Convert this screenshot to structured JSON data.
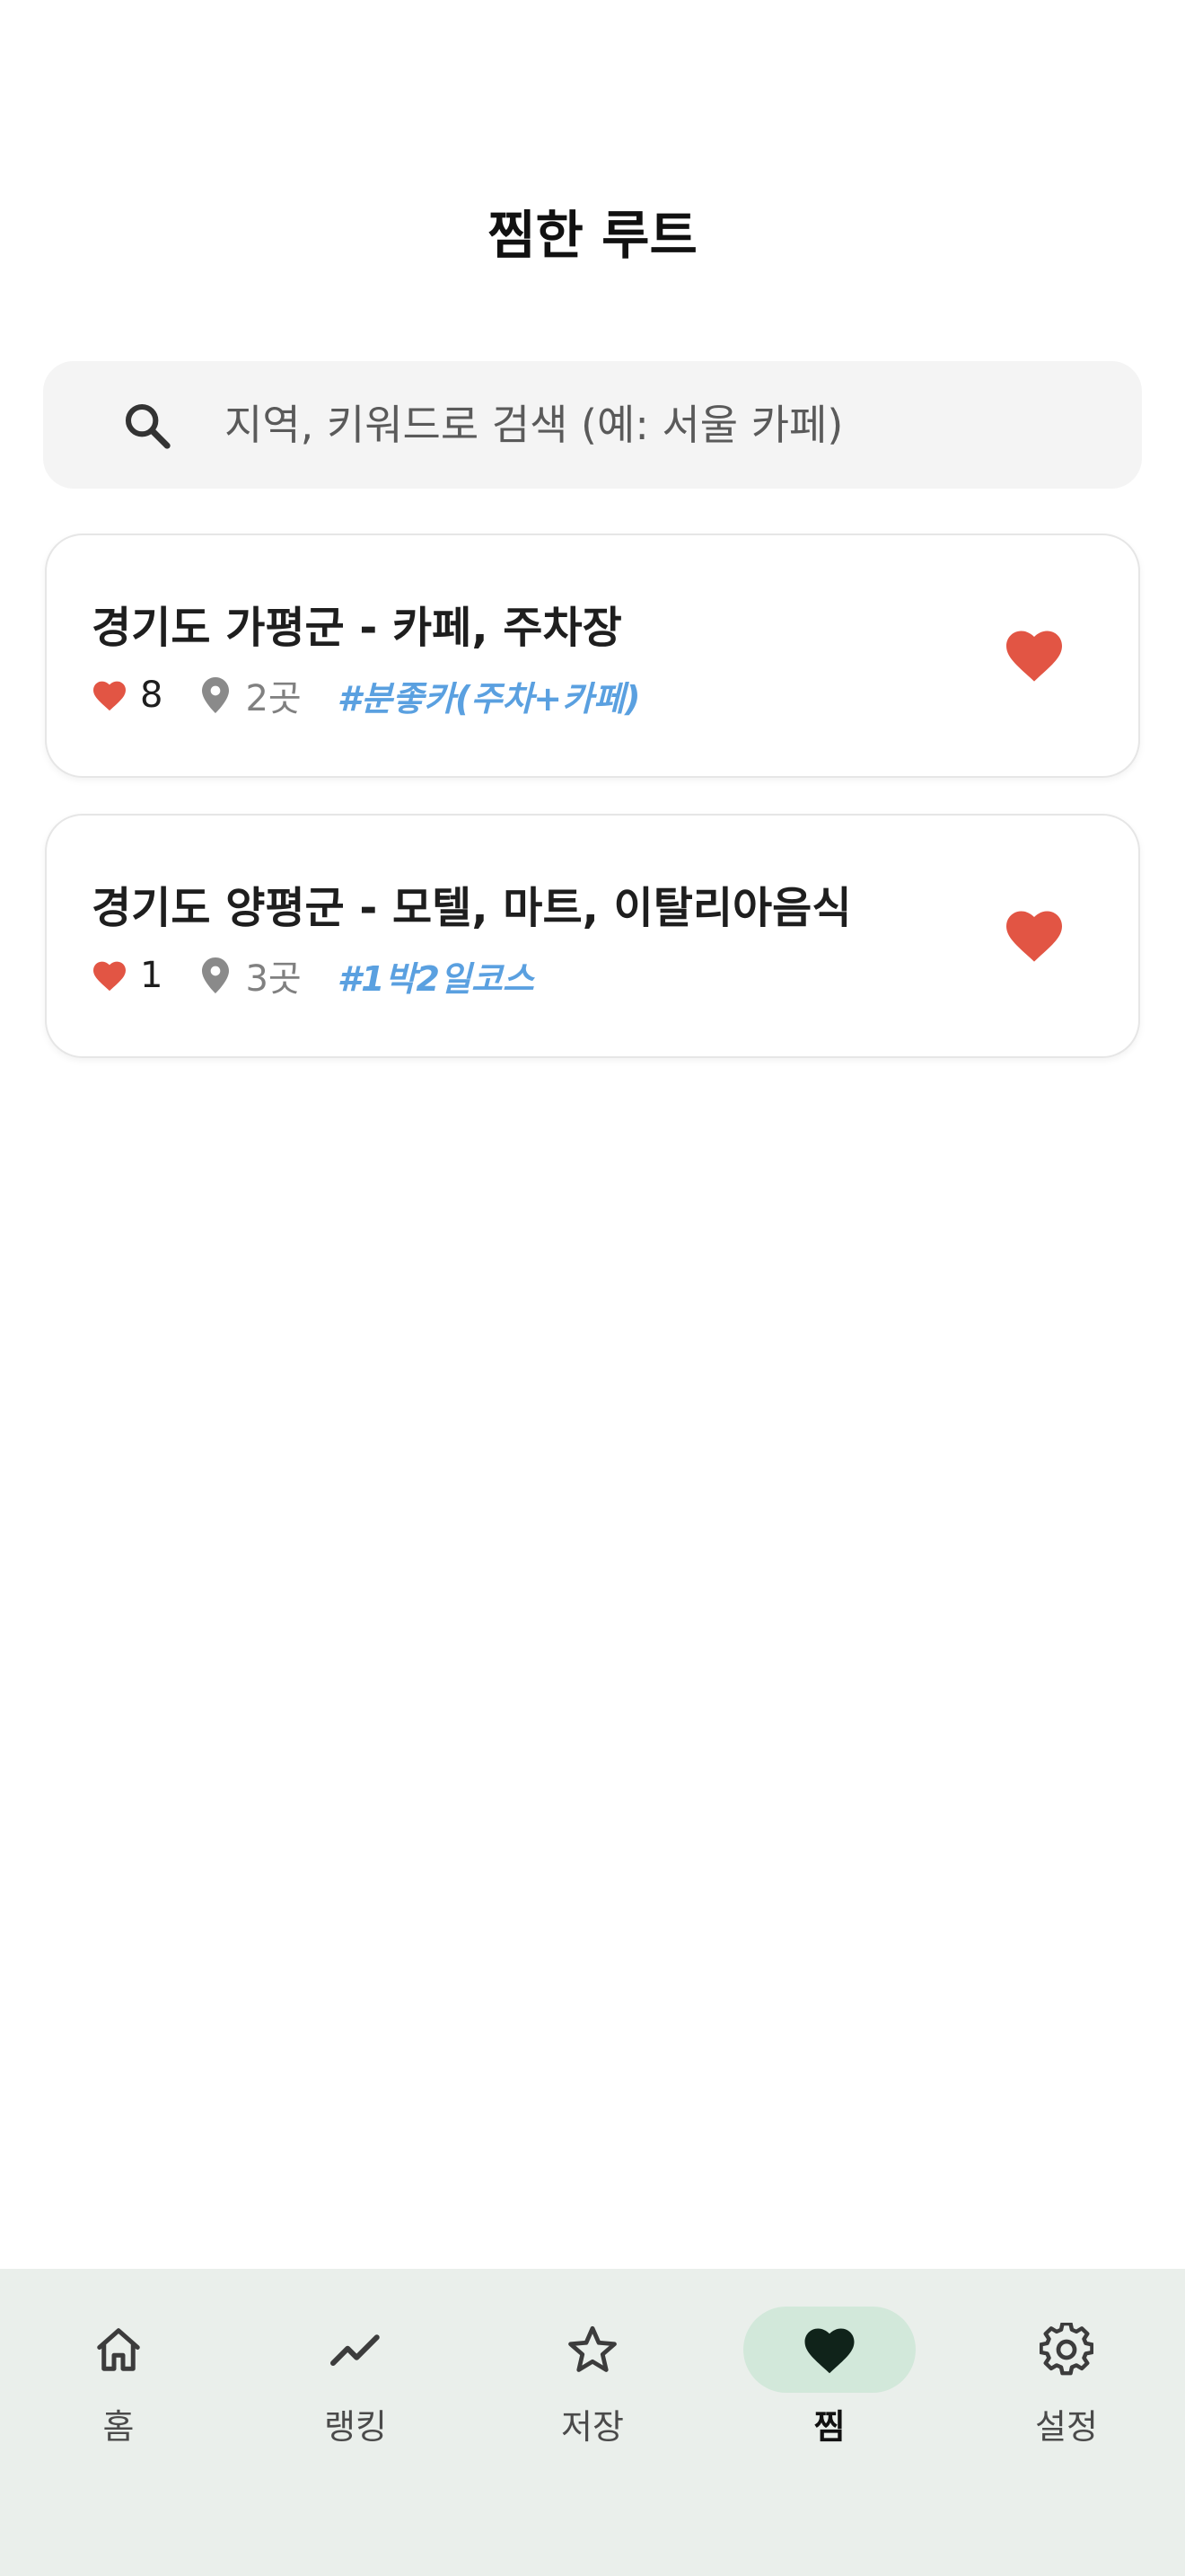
{
  "header": {
    "title": "찜한 루트"
  },
  "search": {
    "placeholder": "지역, 키워드로 검색 (예: 서울 카페)",
    "icon": "search-icon"
  },
  "colors": {
    "heart": "#e25544",
    "tag": "#5aa0e0",
    "nav_active_bg": "#d2e8da",
    "nav_bg": "#eaefeb"
  },
  "routes": [
    {
      "title": "경기도 가평군 - 카페, 주차장",
      "likes": "8",
      "places": "2곳",
      "tag": "#분좋카(주차+카페)"
    },
    {
      "title": "경기도 양평군 - 모텔, 마트, 이탈리아음식",
      "likes": "1",
      "places": "3곳",
      "tag": "#1박2일코스"
    }
  ],
  "nav": {
    "items": [
      {
        "label": "홈",
        "icon": "home-icon"
      },
      {
        "label": "랭킹",
        "icon": "trending-icon"
      },
      {
        "label": "저장",
        "icon": "star-icon"
      },
      {
        "label": "찜",
        "icon": "heart-icon"
      },
      {
        "label": "설정",
        "icon": "gear-icon"
      }
    ],
    "active": "찜"
  }
}
